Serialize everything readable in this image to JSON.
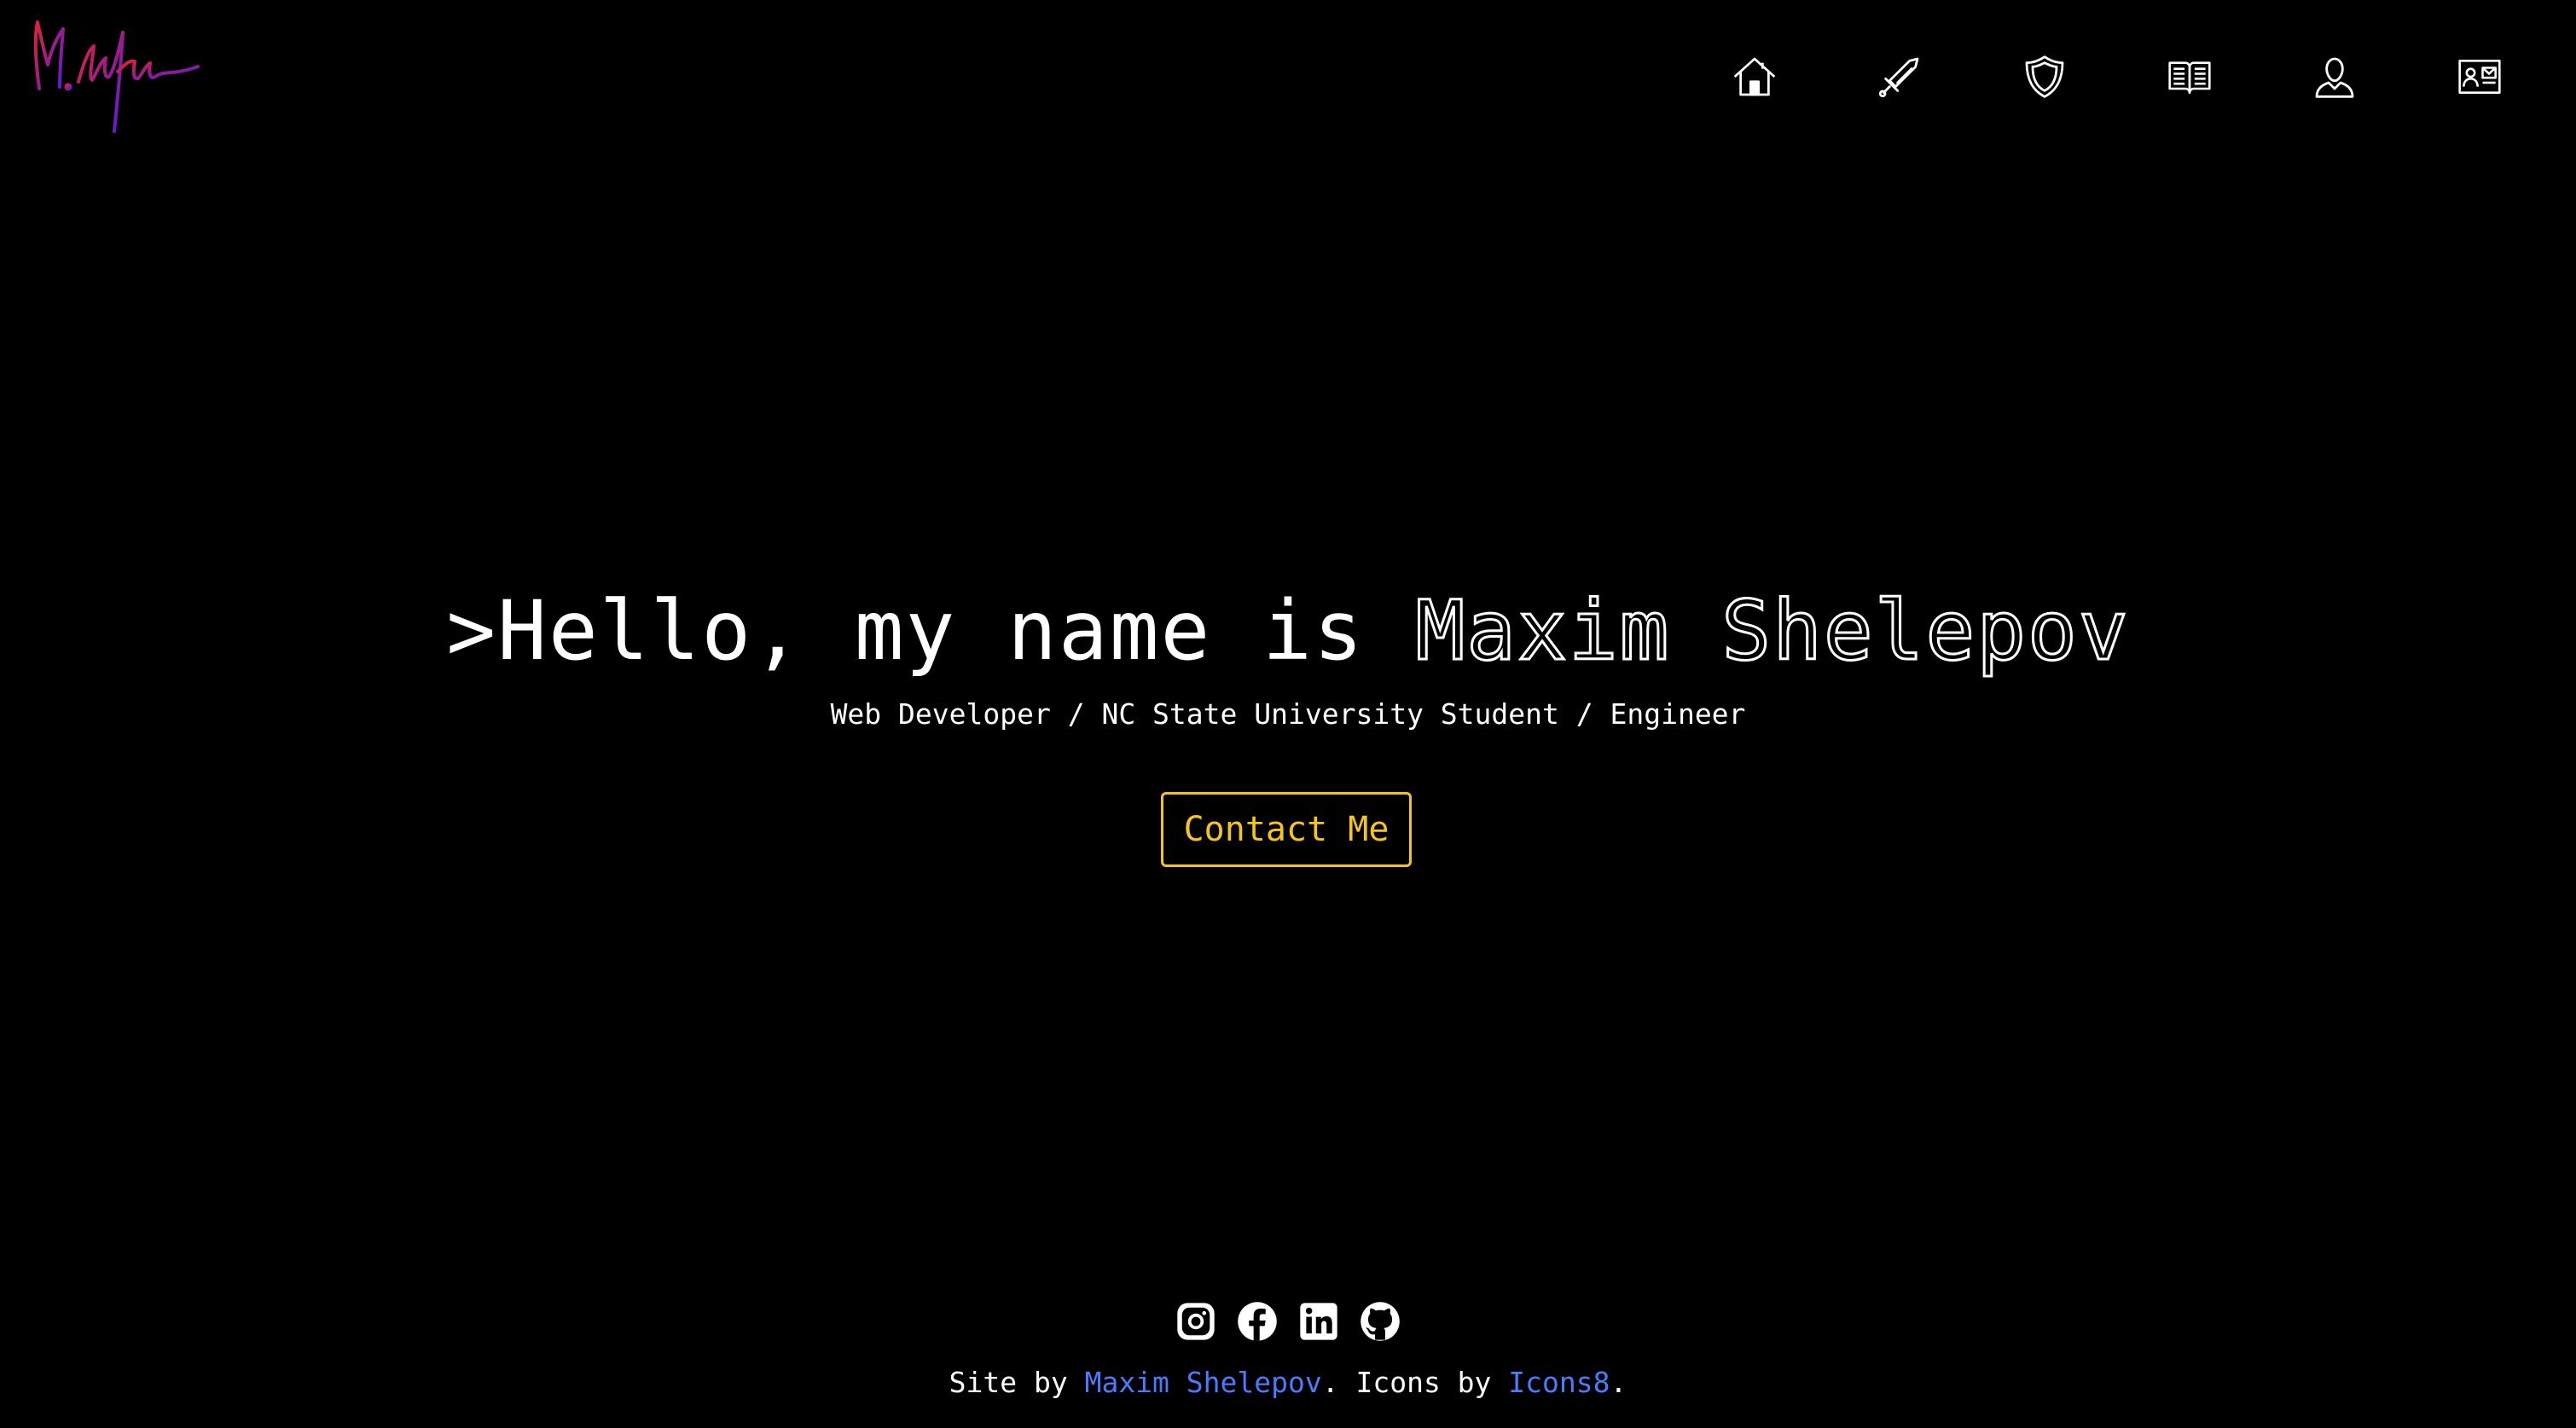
{
  "logo": {
    "alt": "signature-logo"
  },
  "nav": {
    "items": [
      {
        "icon": "home-icon"
      },
      {
        "icon": "sword-icon"
      },
      {
        "icon": "shield-icon"
      },
      {
        "icon": "book-icon"
      },
      {
        "icon": "user-icon"
      },
      {
        "icon": "contact-card-icon"
      }
    ]
  },
  "hero": {
    "greeting": ">Hello, my name is ",
    "name": "Maxim Shelepov",
    "subtitle": "Web Developer / NC State University Student / Engineer",
    "cta_label": "Contact Me"
  },
  "footer": {
    "socials": [
      "instagram-icon",
      "facebook-icon",
      "linkedin-icon",
      "github-icon"
    ],
    "text_site_by": "Site by ",
    "author_link": "Maxim Shelepov",
    "text_icons_by": ". Icons by ",
    "icons_link": "Icons8",
    "text_end": "."
  },
  "colors": {
    "background": "#000000",
    "text": "#ffffff",
    "accent": "#f5c518",
    "link": "#4a7bff",
    "logo_gradient_start": "#e0203a",
    "logo_gradient_end": "#5a1ad8"
  }
}
